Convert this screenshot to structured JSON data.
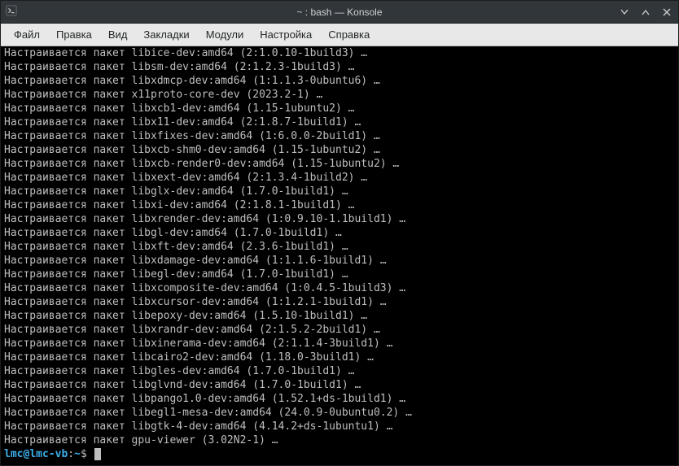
{
  "window": {
    "title": "~ : bash — Konsole"
  },
  "menubar": {
    "items": [
      {
        "label": "Файл"
      },
      {
        "label": "Правка"
      },
      {
        "label": "Вид"
      },
      {
        "label": "Закладки"
      },
      {
        "label": "Модули"
      },
      {
        "label": "Настройка"
      },
      {
        "label": "Справка"
      }
    ]
  },
  "terminal": {
    "prefix": "Настраивается пакет ",
    "lines": [
      "libice-dev:amd64 (2:1.0.10-1build3) …",
      "libsm-dev:amd64 (2:1.2.3-1build3) …",
      "libxdmcp-dev:amd64 (1:1.1.3-0ubuntu6) …",
      "x11proto-core-dev (2023.2-1) …",
      "libxcb1-dev:amd64 (1.15-1ubuntu2) …",
      "libx11-dev:amd64 (2:1.8.7-1build1) …",
      "libxfixes-dev:amd64 (1:6.0.0-2build1) …",
      "libxcb-shm0-dev:amd64 (1.15-1ubuntu2) …",
      "libxcb-render0-dev:amd64 (1.15-1ubuntu2) …",
      "libxext-dev:amd64 (2:1.3.4-1build2) …",
      "libglx-dev:amd64 (1.7.0-1build1) …",
      "libxi-dev:amd64 (2:1.8.1-1build1) …",
      "libxrender-dev:amd64 (1:0.9.10-1.1build1) …",
      "libgl-dev:amd64 (1.7.0-1build1) …",
      "libxft-dev:amd64 (2.3.6-1build1) …",
      "libxdamage-dev:amd64 (1:1.1.6-1build1) …",
      "libegl-dev:amd64 (1.7.0-1build1) …",
      "libxcomposite-dev:amd64 (1:0.4.5-1build3) …",
      "libxcursor-dev:amd64 (1:1.2.1-1build1) …",
      "libepoxy-dev:amd64 (1.5.10-1build1) …",
      "libxrandr-dev:amd64 (2:1.5.2-2build1) …",
      "libxinerama-dev:amd64 (2:1.1.4-3build1) …",
      "libcairo2-dev:amd64 (1.18.0-3build1) …",
      "libgles-dev:amd64 (1.7.0-1build1) …",
      "libglvnd-dev:amd64 (1.7.0-1build1) …",
      "libpango1.0-dev:amd64 (1.52.1+ds-1build1) …",
      "libegl1-mesa-dev:amd64 (24.0.9-0ubuntu0.2) …",
      "libgtk-4-dev:amd64 (4.14.2+ds-1ubuntu1) …",
      "gpu-viewer (3.02N2-1) …"
    ],
    "prompt": {
      "user": "lmc",
      "at": "@",
      "host": "lmc-vb",
      "colon": ":",
      "cwd": "~",
      "dollar": "$"
    }
  }
}
